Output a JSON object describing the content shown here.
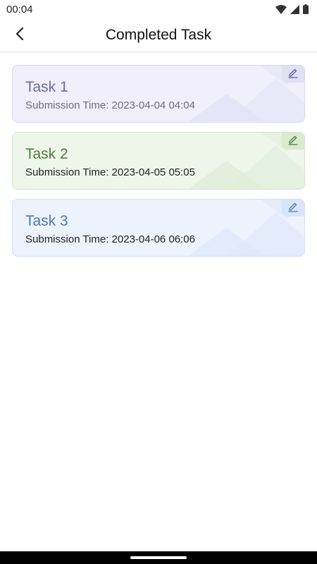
{
  "status_bar": {
    "time": "00:04",
    "icons": [
      "wifi-icon",
      "signal-icon",
      "battery-icon"
    ]
  },
  "header": {
    "title": "Completed Task",
    "back_icon": "chevron-left-icon"
  },
  "tasks": [
    {
      "title": "Task 1",
      "submission_time": "Submission Time: 2023-04-04 04:04",
      "bg": "#f0effb",
      "border": "#d9d7f2",
      "title_color": "#6b6aa6",
      "time_color": "#6e6e7a",
      "edit_bg": "#e2e0f5",
      "icon_color": "#5b5aa0",
      "deco_color": "#e4e2f6",
      "edit_icon": "pencil-icon"
    },
    {
      "title": "Task 2",
      "submission_time": "Submission Time: 2023-04-05 05:05",
      "bg": "#eef6ea",
      "border": "#d3e5cb",
      "title_color": "#4f7a3e",
      "time_color": "#222222",
      "edit_bg": "#d9ead1",
      "icon_color": "#4f7a3e",
      "deco_color": "#e0eed8",
      "edit_icon": "pencil-icon"
    },
    {
      "title": "Task 3",
      "submission_time": "Submission Time: 2023-04-06 06:06",
      "bg": "#edf3fd",
      "border": "#d2e1f8",
      "title_color": "#4d77b0",
      "time_color": "#222222",
      "edit_bg": "#d8e5f8",
      "icon_color": "#4d77b0",
      "deco_color": "#dde8fa",
      "edit_icon": "pencil-icon"
    }
  ]
}
